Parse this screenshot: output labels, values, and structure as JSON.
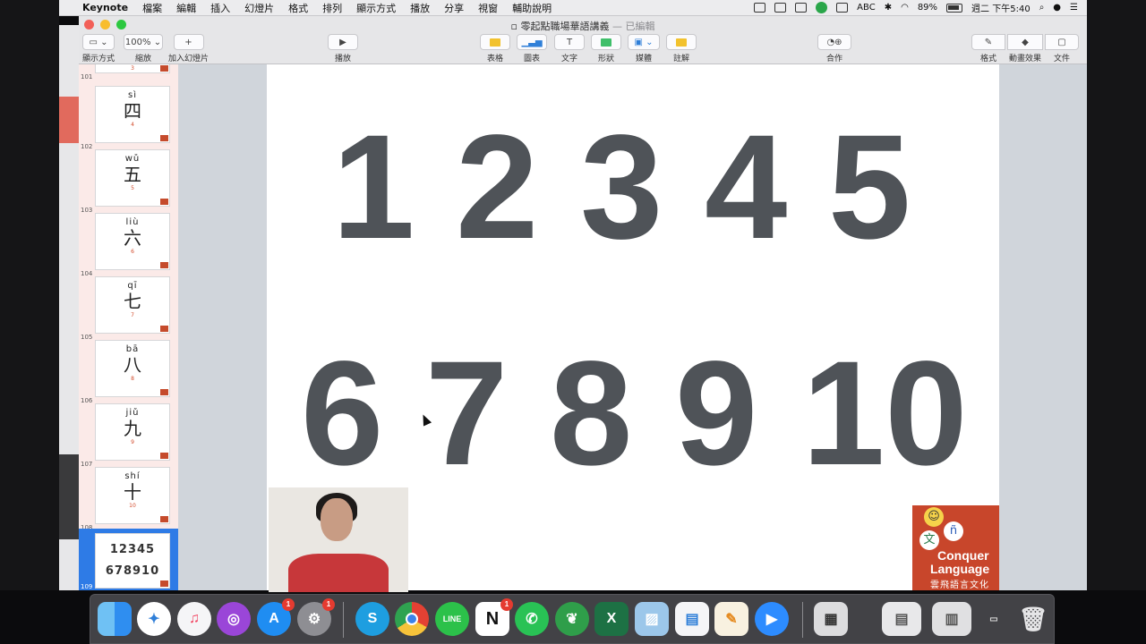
{
  "menubar": {
    "app_name": "Keynote",
    "items": [
      "檔案",
      "編輯",
      "插入",
      "幻燈片",
      "格式",
      "排列",
      "顯示方式",
      "播放",
      "分享",
      "視窗",
      "輔助說明"
    ],
    "status": {
      "input_method": "ABC",
      "battery": "89%",
      "clock": "週二 下午5:40"
    }
  },
  "window": {
    "title": "零起點職場華語講義",
    "edited_suffix": "— 已編輯"
  },
  "toolbar": {
    "view_label": "顯示方式",
    "zoom_value": "100%",
    "zoom_label": "縮放",
    "add_slide_label": "加入幻燈片",
    "play_label": "播放",
    "table_label": "表格",
    "chart_label": "圖表",
    "text_label": "文字",
    "shape_label": "形狀",
    "media_label": "媒體",
    "comment_label": "註解",
    "collab_label": "合作",
    "format_label": "格式",
    "animate_label": "動畫效果",
    "document_label": "文件"
  },
  "navigator": {
    "partial_slide": {
      "number": "101",
      "small": "3"
    },
    "slides": [
      {
        "number": "102",
        "pinyin": "sì",
        "hanzi": "四",
        "small": "4"
      },
      {
        "number": "103",
        "pinyin": "wǔ",
        "hanzi": "五",
        "small": "5"
      },
      {
        "number": "104",
        "pinyin": "liù",
        "hanzi": "六",
        "small": "6"
      },
      {
        "number": "105",
        "pinyin": "qī",
        "hanzi": "七",
        "small": "7"
      },
      {
        "number": "106",
        "pinyin": "bā",
        "hanzi": "八",
        "small": "8"
      },
      {
        "number": "107",
        "pinyin": "jiǔ",
        "hanzi": "九",
        "small": "9"
      },
      {
        "number": "108",
        "pinyin": "shí",
        "hanzi": "十",
        "small": "10"
      }
    ],
    "selected_slide": {
      "number": "109",
      "row1": "12345",
      "row2": "678910"
    }
  },
  "slide": {
    "row1": [
      "1",
      "2",
      "3",
      "4",
      "5"
    ],
    "row2": [
      "6",
      "7",
      "8",
      "9",
      "10"
    ],
    "logo": {
      "char_wen": "文",
      "char_n": "ñ",
      "line1": "Conquer",
      "line2": "Language",
      "line3": "雲飛語言文化"
    }
  },
  "dock": {
    "apps": [
      {
        "name": "finder",
        "label": ""
      },
      {
        "name": "safari",
        "label": ""
      },
      {
        "name": "music",
        "label": "♫"
      },
      {
        "name": "podcasts",
        "label": ""
      },
      {
        "name": "app-store",
        "label": "A",
        "badge": "1"
      },
      {
        "name": "system-preferences",
        "label": "⚙",
        "badge": "1"
      },
      {
        "name": "skype",
        "label": "S"
      },
      {
        "name": "chrome",
        "label": ""
      },
      {
        "name": "line",
        "label": "LINE"
      },
      {
        "name": "notion",
        "label": "N",
        "badge": "1"
      },
      {
        "name": "whatsapp",
        "label": ""
      },
      {
        "name": "evernote",
        "label": ""
      },
      {
        "name": "excel",
        "label": "X"
      },
      {
        "name": "preview",
        "label": ""
      },
      {
        "name": "keynote",
        "label": ""
      },
      {
        "name": "pages",
        "label": ""
      },
      {
        "name": "zoom",
        "label": ""
      }
    ]
  },
  "colors": {
    "digit": "#4f5358",
    "nav_bg": "#fbeae8",
    "selected": "#2e7be6",
    "logo_bg": "#c8462b"
  }
}
